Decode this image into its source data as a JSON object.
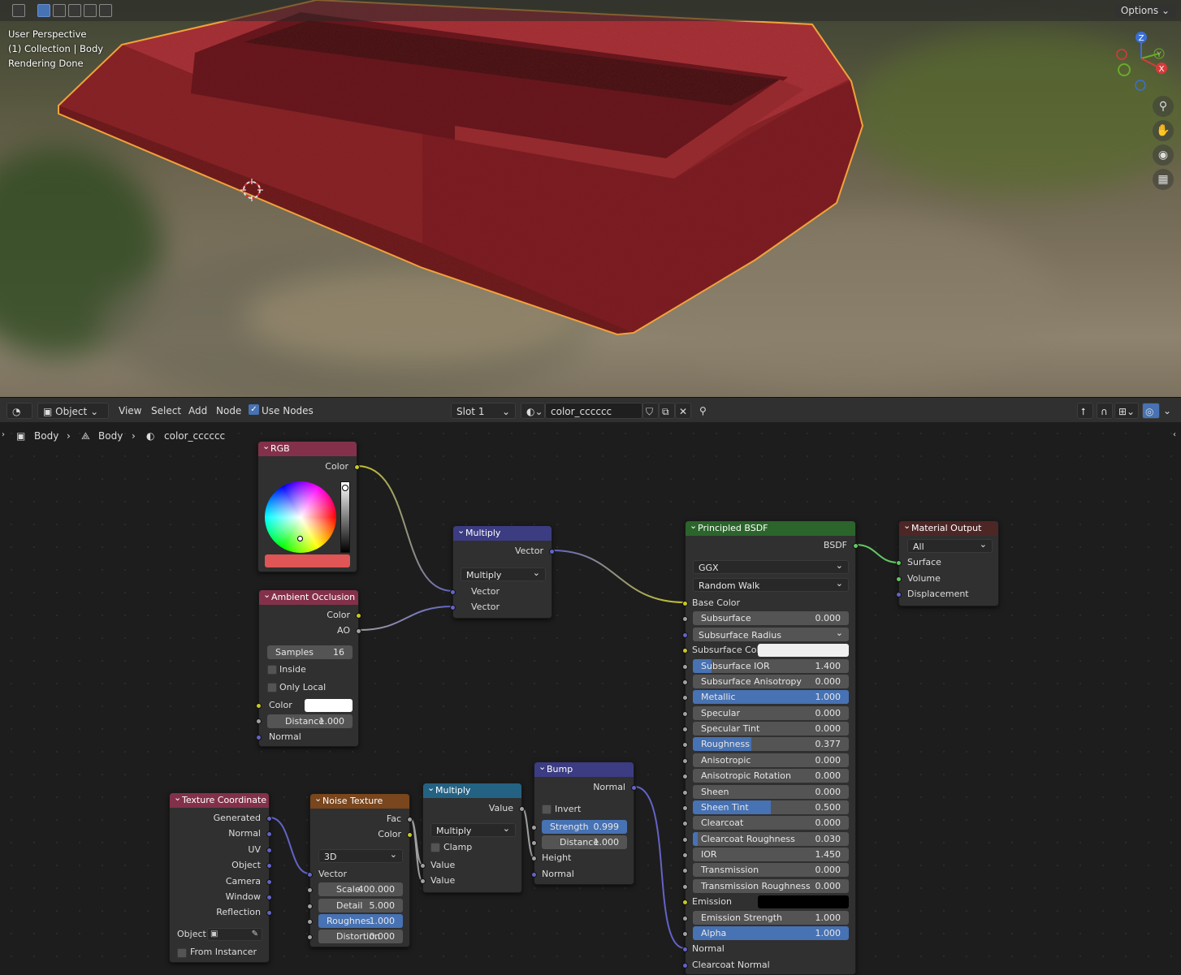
{
  "viewport": {
    "options_label": "Options",
    "overlay": [
      "User Perspective",
      "(1) Collection | Body",
      "Rendering Done"
    ],
    "gizmo": {
      "z": "Z",
      "y": "Y",
      "x": "X"
    }
  },
  "editor_header": {
    "mode": "Object",
    "menus": [
      "View",
      "Select",
      "Add",
      "Node"
    ],
    "use_nodes": "Use Nodes",
    "slot": "Slot 1",
    "material": "color_cccccc"
  },
  "breadcrumb": [
    "Body",
    "Body",
    "color_cccccc"
  ],
  "nodes": {
    "rgb": {
      "title": "RGB",
      "out_color": "Color",
      "swatch": "#e05555"
    },
    "ao": {
      "title": "Ambient Occlusion",
      "out_color": "Color",
      "out_ao": "AO",
      "samples_label": "Samples",
      "samples": "16",
      "inside": "Inside",
      "only_local": "Only Local",
      "color": "Color",
      "distance_label": "Distance",
      "distance": "1.000",
      "normal": "Normal"
    },
    "multiply_vec": {
      "title": "Multiply",
      "out": "Vector",
      "op": "Multiply",
      "in1": "Vector",
      "in2": "Vector"
    },
    "bsdf": {
      "title": "Principled BSDF",
      "out": "BSDF",
      "dist": "GGX",
      "sss_method": "Random Walk",
      "base_color": "Base Color",
      "subsurface_radius": "Subsurface Radius",
      "subsurface_color": "Subsurface Colo",
      "fields": [
        {
          "label": "Subsurface",
          "value": "0.000",
          "fill": 0
        },
        {
          "label": "Subsurface IOR",
          "value": "1.400",
          "fill": 0.12
        },
        {
          "label": "Subsurface Anisotropy",
          "value": "0.000",
          "fill": 0
        },
        {
          "label": "Metallic",
          "value": "1.000",
          "fill": 1
        },
        {
          "label": "Specular",
          "value": "0.000",
          "fill": 0
        },
        {
          "label": "Specular Tint",
          "value": "0.000",
          "fill": 0
        },
        {
          "label": "Roughness",
          "value": "0.377",
          "fill": 0.377
        },
        {
          "label": "Anisotropic",
          "value": "0.000",
          "fill": 0
        },
        {
          "label": "Anisotropic Rotation",
          "value": "0.000",
          "fill": 0
        },
        {
          "label": "Sheen",
          "value": "0.000",
          "fill": 0
        },
        {
          "label": "Sheen Tint",
          "value": "0.500",
          "fill": 0.5
        },
        {
          "label": "Clearcoat",
          "value": "0.000",
          "fill": 0
        },
        {
          "label": "Clearcoat Roughness",
          "value": "0.030",
          "fill": 0.03
        },
        {
          "label": "IOR",
          "value": "1.450",
          "fill": 0
        },
        {
          "label": "Transmission",
          "value": "0.000",
          "fill": 0
        },
        {
          "label": "Transmission Roughness",
          "value": "0.000",
          "fill": 0
        }
      ],
      "emission": "Emission",
      "emission_strength": {
        "label": "Emission Strength",
        "value": "1.000"
      },
      "alpha": {
        "label": "Alpha",
        "value": "1.000",
        "fill": 1
      },
      "normal": "Normal",
      "clearcoat_normal": "Clearcoat Normal"
    },
    "output": {
      "title": "Material Output",
      "target": "All",
      "surface": "Surface",
      "volume": "Volume",
      "displacement": "Displacement"
    },
    "texcoord": {
      "title": "Texture Coordinate",
      "outs": [
        "Generated",
        "Normal",
        "UV",
        "Object",
        "Camera",
        "Window",
        "Reflection"
      ],
      "object_label": "Object:",
      "from_instancer": "From Instancer"
    },
    "noise": {
      "title": "Noise Texture",
      "out_fac": "Fac",
      "out_color": "Color",
      "dim": "3D",
      "vector": "Vector",
      "scale_label": "Scale",
      "scale": "400.000",
      "detail_label": "Detail",
      "detail": "5.000",
      "rough_label": "Roughnes",
      "rough": "1.000",
      "distortion_label": "Distortion",
      "distortion": "0.000"
    },
    "multiply_math": {
      "title": "Multiply",
      "out": "Value",
      "op": "Multiply",
      "clamp": "Clamp",
      "in1": "Value",
      "in2": "Value"
    },
    "bump": {
      "title": "Bump",
      "out": "Normal",
      "invert": "Invert",
      "strength_label": "Strength",
      "strength": "0.999",
      "distance_label": "Distance",
      "distance": "1.000",
      "height": "Height",
      "normal": "Normal"
    }
  },
  "colors": {
    "link_color": "#c7c729",
    "link_vector": "#6363c7",
    "link_shader": "#63c763",
    "link_gray": "#a1a1a1",
    "selection": "#f2a23a"
  }
}
